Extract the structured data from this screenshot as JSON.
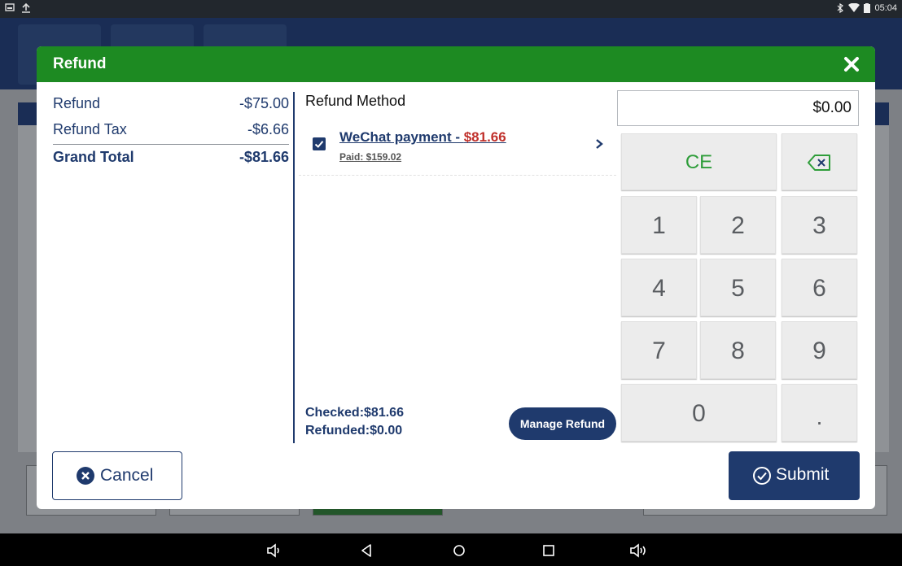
{
  "status_bar": {
    "time": "05:04",
    "icons": [
      "screenshot-icon",
      "upload-icon",
      "bluetooth-icon",
      "wifi-icon",
      "battery-icon"
    ]
  },
  "dialog": {
    "title": "Refund",
    "header_color": "#1d8a22",
    "summary": {
      "refund_label": "Refund",
      "refund_value": "-$75.00",
      "tax_label": "Refund Tax",
      "tax_value": "-$6.66",
      "total_label": "Grand Total",
      "total_value": "-$81.66"
    },
    "refund_method": {
      "title": "Refund Method",
      "items": [
        {
          "name": "WeChat payment - ",
          "amount": "$81.66",
          "paid": "Paid: $159.02",
          "checked": true
        }
      ],
      "checked_text": "Checked:$81.66",
      "refunded_text": "Refunded:$0.00",
      "manage_label": "Manage Refund"
    },
    "numpad": {
      "amount": "$0.00",
      "ce_label": "CE",
      "keys": [
        "1",
        "2",
        "3",
        "4",
        "5",
        "6",
        "7",
        "8",
        "9"
      ],
      "zero": "0",
      "dot": "."
    },
    "cancel_label": "Cancel",
    "submit_label": "Submit"
  },
  "colors": {
    "navy": "#1f3a6d",
    "green": "#1d8a22",
    "red_amount": "#c0302b",
    "ce_green": "#2e9d3a"
  },
  "nav_bar": {
    "icons": [
      "volume-down-icon",
      "back-icon",
      "home-icon",
      "recents-icon",
      "volume-up-icon"
    ]
  }
}
